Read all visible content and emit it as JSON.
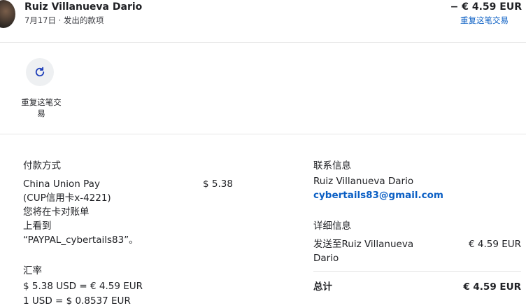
{
  "header": {
    "name": "Ruiz Villanueva Dario",
    "date": "7月17日",
    "separator": "·",
    "type": "发出的款项",
    "amount": "− € 4.59 EUR",
    "repeat_link": "重复这笔交易"
  },
  "actions": {
    "repeat_label": "重复这笔交易"
  },
  "payment": {
    "heading": "付款方式",
    "method_lines": [
      "China Union Pay",
      "(CUP信用卡x-4221)",
      "您将在卡对账单",
      "上看到",
      "“PAYPAL_cybertails83”。"
    ],
    "method_amount": "$ 5.38"
  },
  "exchange": {
    "heading": "汇率",
    "line1": "$ 5.38 USD = € 4.59 EUR",
    "line2": "1 USD = $ 0.8537 EUR"
  },
  "contact": {
    "heading": "联系信息",
    "name": "Ruiz Villanueva Dario",
    "email": "cybertails83@gmail.com"
  },
  "details": {
    "heading": "详细信息",
    "sent_to_line1": "发送至Ruiz Villanueva",
    "sent_to_line2": "Dario",
    "sent_amount": "€ 4.59 EUR",
    "total_label": "总计",
    "total_amount": "€ 4.59 EUR"
  }
}
